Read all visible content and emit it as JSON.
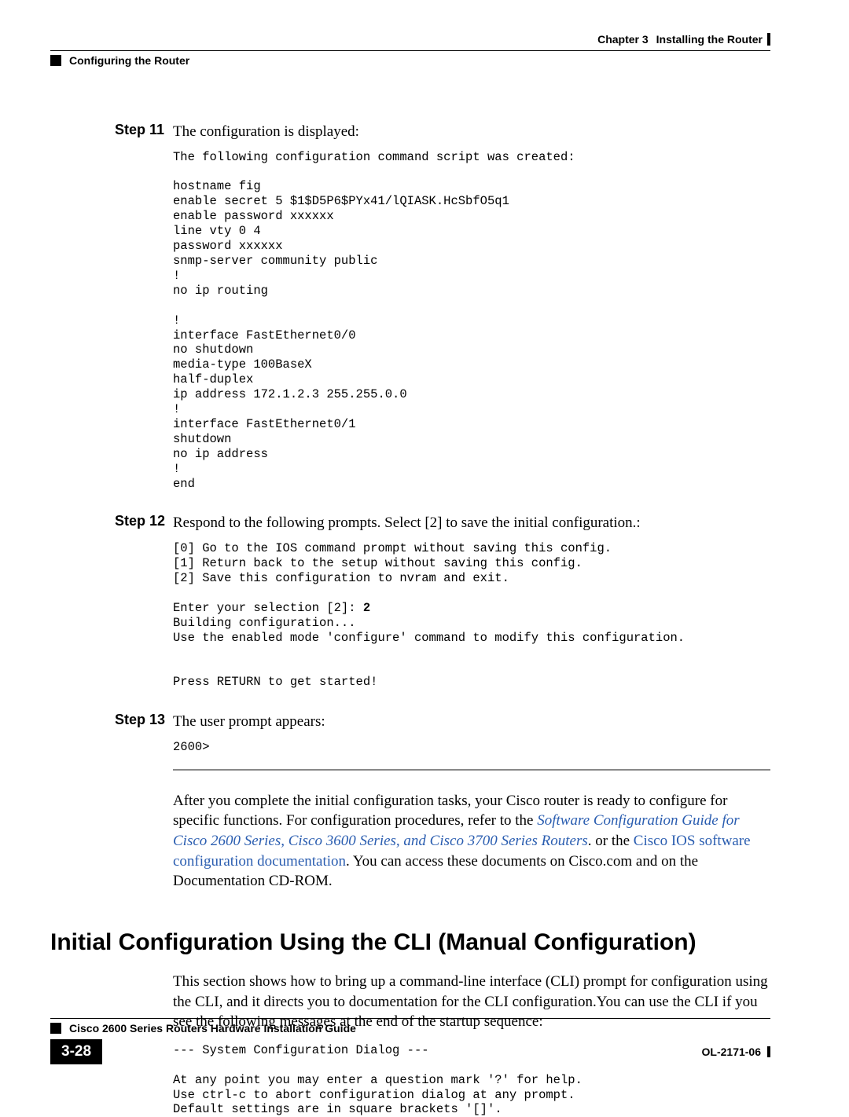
{
  "header": {
    "chapter_label": "Chapter 3",
    "chapter_title": "Installing the Router",
    "section_title": "Configuring the Router"
  },
  "steps": {
    "s11": {
      "label": "Step 11",
      "text": "The configuration is displayed:",
      "code": "The following configuration command script was created:\n\nhostname fig\nenable secret 5 $1$D5P6$PYx41/lQIASK.HcSbfO5q1\nenable password xxxxxx\nline vty 0 4\npassword xxxxxx\nsnmp-server community public\n!\nno ip routing\n\n!\ninterface FastEthernet0/0\nno shutdown\nmedia-type 100BaseX\nhalf-duplex\nip address 172.1.2.3 255.255.0.0\n!\ninterface FastEthernet0/1\nshutdown\nno ip address\n!\nend"
    },
    "s12": {
      "label": "Step 12",
      "text": "Respond to the following prompts. Select [2] to save the initial configuration.:",
      "code_a": "[0] Go to the IOS command prompt without saving this config.\n[1] Return back to the setup without saving this config.\n[2] Save this configuration to nvram and exit.\n\nEnter your selection [2]: ",
      "code_bold": "2",
      "code_b": "\nBuilding configuration...\nUse the enabled mode 'configure' command to modify this configuration.\n\n\nPress RETURN to get started!"
    },
    "s13": {
      "label": "Step 13",
      "text": "The user prompt appears:",
      "code": "2600>"
    }
  },
  "para": {
    "p1a": "After you complete the initial configuration tasks, your Cisco router is ready to configure for specific functions. For configuration procedures, refer to the ",
    "link1": "Software Configuration Guide for Cisco 2600 Series, Cisco 3600 Series, and Cisco 3700 Series Routers",
    "p1b": ". or the ",
    "link2": "Cisco IOS software configuration documentation",
    "p1c": ". You can access these documents on Cisco.com and on the Documentation CD-ROM."
  },
  "heading": "Initial Configuration Using the CLI (Manual Configuration)",
  "para2": "This section shows how to bring up a command-line interface (CLI) prompt for configuration using the CLI, and it directs you to documentation for the CLI configuration.You can use the CLI if you see the following messages at the end of the startup sequence:",
  "code2": "--- System Configuration Dialog ---\n\nAt any point you may enter a question mark '?' for help.\nUse ctrl-c to abort configuration dialog at any prompt.\nDefault settings are in square brackets '[]'.",
  "footer": {
    "guide_title": "Cisco 2600 Series Routers Hardware Installation Guide",
    "page_num": "3-28",
    "doc_id": "OL-2171-06"
  }
}
